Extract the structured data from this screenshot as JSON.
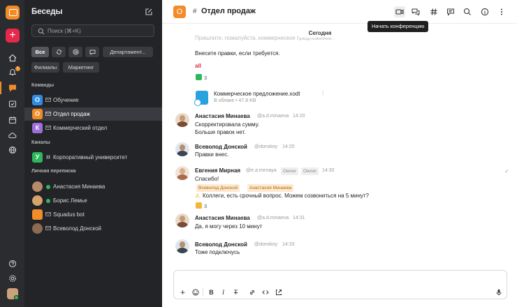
{
  "colors": {
    "accent": "#f28c28",
    "danger": "#e6284a",
    "online": "#2db85d"
  },
  "sidebar": {
    "title": "Беседы",
    "search_placeholder": "Поиск (⌘+K)",
    "filters": [
      "Все",
      "Департамент...",
      "Филиалы",
      "Маркетинг"
    ],
    "section_teams": "Команды",
    "section_channels": "Каналы",
    "section_personal": "Личная переписка",
    "teams": [
      {
        "avatar": "О",
        "label": "Обучение",
        "color": "#2f8de4"
      },
      {
        "avatar": "О",
        "label": "Отдел продаж",
        "color": "#f28c28"
      },
      {
        "avatar": "К",
        "label": "Коммерческий отдел",
        "color": "#9b6fd8"
      }
    ],
    "channels": [
      {
        "avatar": "У",
        "label": "Корпоративный университет",
        "color": "#2db85d"
      }
    ],
    "personal": [
      {
        "label": "Анастасия Минаева"
      },
      {
        "label": "Борис Лемье"
      },
      {
        "label": "Squadus bot"
      },
      {
        "label": "Всеволод Донской"
      }
    ],
    "rail_badge": "1"
  },
  "header": {
    "avatar": "О",
    "hash": "#",
    "title": "Отдел продаж",
    "tooltip": "Начать конференцию"
  },
  "chat": {
    "date": "Сегодня",
    "partial_line": "Пришлите, пожалуйста, коммерческое предложение.",
    "request_line": "Внесите правки, если требуется.",
    "mention_all": "all",
    "reaction_1": "3",
    "file_name": "Коммерческое предложение.xodt",
    "file_meta": "В облаке • 47.8 KB",
    "messages": [
      {
        "author": "Анастасия Минаева",
        "handle": "@a.d.minaeva",
        "time": "14:20",
        "lines": [
          "Скорректировала сумму.",
          "Больше правок нет."
        ]
      },
      {
        "author": "Всеволод Донской",
        "handle": "@donskoy",
        "time": "14:20",
        "lines": [
          "Правки внес."
        ]
      },
      {
        "author": "Евгения Мирная",
        "handle": "@e.a.mirnaya",
        "badge1": "Owner",
        "badge2": "Owner",
        "time": "14:30",
        "lines": [
          "Спасибо!"
        ],
        "mentions": [
          "Всеволод Донской",
          "Анастасия Минаева"
        ],
        "warning": "Коллеги, есть срочный вопрос. Можем созвониться на 5 минут?",
        "reaction": "3"
      },
      {
        "author": "Анастасия Минаева",
        "handle": "@a.d.minaeva",
        "time": "14:31",
        "lines": [
          "Да, я могу через 10 минут"
        ]
      },
      {
        "author": "Всеволод Донской",
        "handle": "@donskoy",
        "time": "14:33",
        "lines": [
          "Тоже подключусь"
        ]
      }
    ]
  },
  "composer": {
    "placeholder": ""
  }
}
